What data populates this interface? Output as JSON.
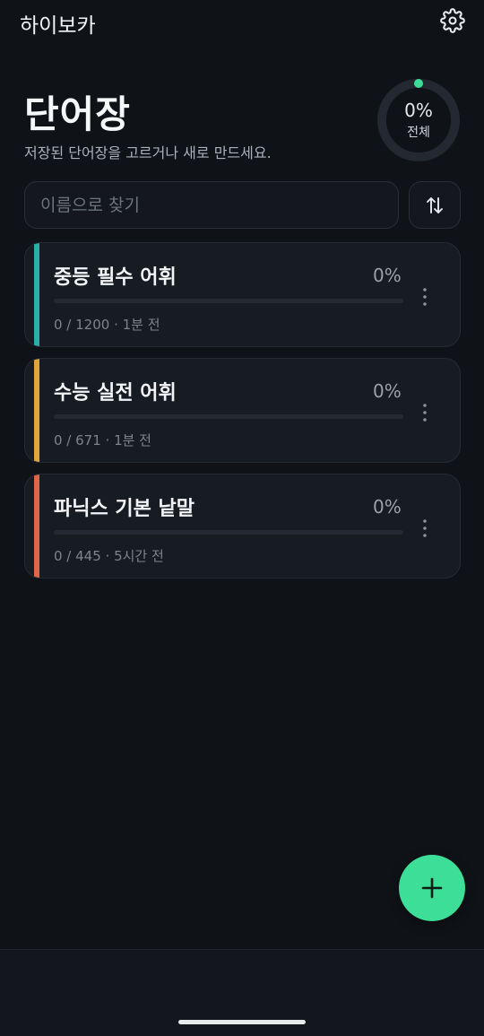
{
  "app": {
    "title": "하이보카"
  },
  "header": {
    "title": "단어장",
    "subtitle": "저장된 단어장을 고르거나 새로 만드세요."
  },
  "overall": {
    "percent_label": "0%",
    "label": "전체",
    "fraction": 0
  },
  "search": {
    "placeholder": "이름으로 찾기",
    "value": ""
  },
  "decks": [
    {
      "title": "중등 필수 어휘",
      "percent_label": "0%",
      "progress": 0,
      "meta": "0 / 1200 · 1분 전",
      "accent": "#2bb0a8"
    },
    {
      "title": "수능 실전 어휘",
      "percent_label": "0%",
      "progress": 0,
      "meta": "0 / 671 · 1분 전",
      "accent": "#e0a53a"
    },
    {
      "title": "파닉스 기본 낱말",
      "percent_label": "0%",
      "progress": 0,
      "meta": "0 / 445 · 5시간 전",
      "accent": "#e0664a"
    }
  ],
  "icons": {
    "settings": "gear-icon",
    "sort": "sort-arrows-icon",
    "more": "more-vertical-icon",
    "add": "plus-icon"
  },
  "colors": {
    "accent": "#3dde97",
    "background": "#0f1217",
    "card": "#171b22"
  }
}
